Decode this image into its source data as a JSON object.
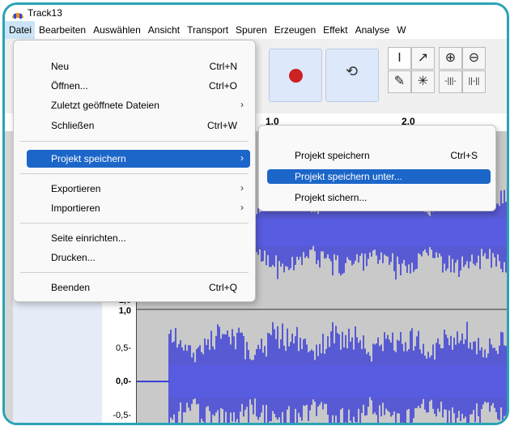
{
  "window": {
    "title": "Track13"
  },
  "menubar": [
    "Datei",
    "Bearbeiten",
    "Auswählen",
    "Ansicht",
    "Transport",
    "Spuren",
    "Erzeugen",
    "Effekt",
    "Analyse",
    "W"
  ],
  "file_menu": {
    "items": [
      {
        "label": "Neu",
        "shortcut": "Ctrl+N"
      },
      {
        "label": "Öffnen...",
        "shortcut": "Ctrl+O"
      },
      {
        "label": "Zuletzt geöffnete Dateien",
        "shortcut": ""
      },
      {
        "label": "Schließen",
        "shortcut": "Ctrl+W"
      },
      {
        "label": "Projekt speichern",
        "shortcut": ""
      },
      {
        "label": "Exportieren",
        "shortcut": ""
      },
      {
        "label": "Importieren",
        "shortcut": ""
      },
      {
        "label": "Seite einrichten...",
        "shortcut": ""
      },
      {
        "label": "Drucken...",
        "shortcut": ""
      },
      {
        "label": "Beenden",
        "shortcut": "Ctrl+Q"
      }
    ]
  },
  "save_submenu": {
    "items": [
      {
        "label": "Projekt speichern",
        "shortcut": "Ctrl+S"
      },
      {
        "label": "Projekt speichern unter...",
        "shortcut": ""
      },
      {
        "label": "Projekt sichern...",
        "shortcut": ""
      }
    ]
  },
  "timeline": {
    "labels": [
      "1,0",
      "2,0"
    ]
  },
  "track_scale": {
    "labels": [
      "-1,0",
      "1,0",
      "0,5-",
      "0,0-",
      "-0,5-"
    ]
  },
  "colors": {
    "accent": "#1c66c9",
    "frame": "#2aa3b5",
    "waveform": "#3b3fd6",
    "record": "#cc2222"
  },
  "icons": [
    "record-icon",
    "loop-icon",
    "selection-tool-icon",
    "envelope-tool-icon",
    "draw-tool-icon",
    "multi-tool-icon",
    "zoom-in-icon",
    "zoom-out-icon",
    "trim-icon",
    "silence-icon",
    "submenu-arrow-icon"
  ]
}
